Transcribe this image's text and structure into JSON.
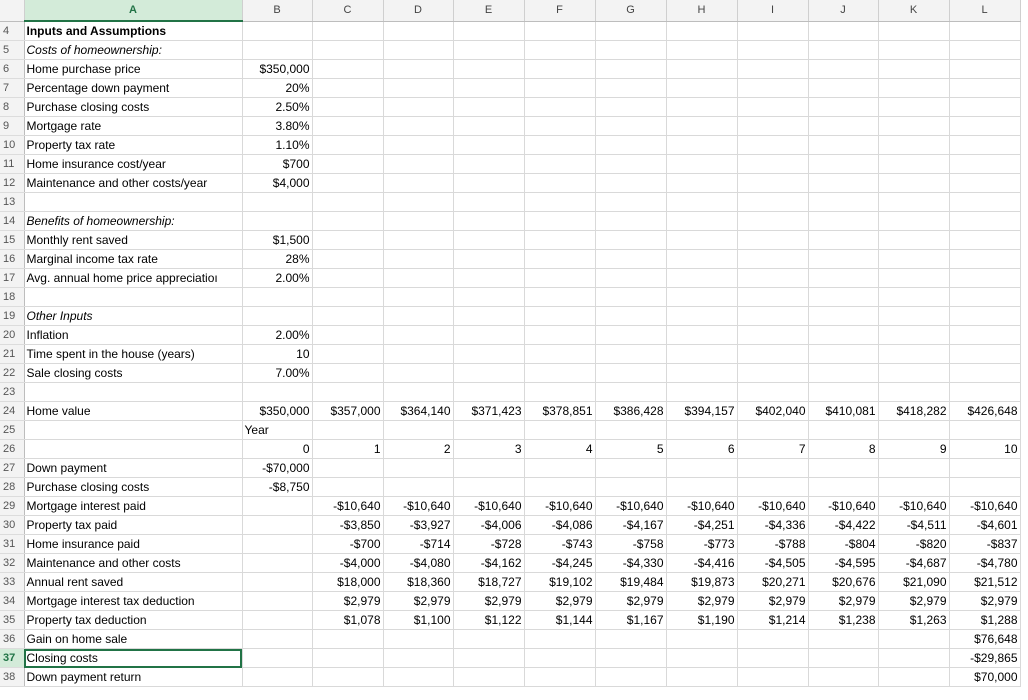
{
  "columns": [
    "A",
    "B",
    "C",
    "D",
    "E",
    "F",
    "G",
    "H",
    "I",
    "J",
    "K",
    "L"
  ],
  "active_cell": {
    "row": "37",
    "col": "A"
  },
  "rows": [
    {
      "n": "4",
      "cells": [
        "Inputs and Assumptions",
        "",
        "",
        "",
        "",
        "",
        "",
        "",
        "",
        "",
        "",
        ""
      ],
      "style": "bold"
    },
    {
      "n": "5",
      "cells": [
        "Costs of homeownership:",
        "",
        "",
        "",
        "",
        "",
        "",
        "",
        "",
        "",
        "",
        ""
      ],
      "style": "italic"
    },
    {
      "n": "6",
      "cells": [
        "Home purchase price",
        "$350,000",
        "",
        "",
        "",
        "",
        "",
        "",
        "",
        "",
        "",
        ""
      ]
    },
    {
      "n": "7",
      "cells": [
        "Percentage down payment",
        "20%",
        "",
        "",
        "",
        "",
        "",
        "",
        "",
        "",
        "",
        ""
      ]
    },
    {
      "n": "8",
      "cells": [
        "Purchase closing costs",
        "2.50%",
        "",
        "",
        "",
        "",
        "",
        "",
        "",
        "",
        "",
        ""
      ]
    },
    {
      "n": "9",
      "cells": [
        "Mortgage rate",
        "3.80%",
        "",
        "",
        "",
        "",
        "",
        "",
        "",
        "",
        "",
        ""
      ]
    },
    {
      "n": "10",
      "cells": [
        "Property tax rate",
        "1.10%",
        "",
        "",
        "",
        "",
        "",
        "",
        "",
        "",
        "",
        ""
      ]
    },
    {
      "n": "11",
      "cells": [
        "Home insurance cost/year",
        "$700",
        "",
        "",
        "",
        "",
        "",
        "",
        "",
        "",
        "",
        ""
      ]
    },
    {
      "n": "12",
      "cells": [
        "Maintenance and other costs/year",
        "$4,000",
        "",
        "",
        "",
        "",
        "",
        "",
        "",
        "",
        "",
        ""
      ]
    },
    {
      "n": "13",
      "cells": [
        "",
        "",
        "",
        "",
        "",
        "",
        "",
        "",
        "",
        "",
        "",
        ""
      ]
    },
    {
      "n": "14",
      "cells": [
        "Benefits of homeownership:",
        "",
        "",
        "",
        "",
        "",
        "",
        "",
        "",
        "",
        "",
        ""
      ],
      "style": "italic"
    },
    {
      "n": "15",
      "cells": [
        "Monthly rent saved",
        "$1,500",
        "",
        "",
        "",
        "",
        "",
        "",
        "",
        "",
        "",
        ""
      ]
    },
    {
      "n": "16",
      "cells": [
        "Marginal income tax rate",
        "28%",
        "",
        "",
        "",
        "",
        "",
        "",
        "",
        "",
        "",
        ""
      ]
    },
    {
      "n": "17",
      "cells": [
        "Avg. annual home price appreciatioı",
        "2.00%",
        "",
        "",
        "",
        "",
        "",
        "",
        "",
        "",
        "",
        ""
      ]
    },
    {
      "n": "18",
      "cells": [
        "",
        "",
        "",
        "",
        "",
        "",
        "",
        "",
        "",
        "",
        "",
        ""
      ]
    },
    {
      "n": "19",
      "cells": [
        "Other Inputs",
        "",
        "",
        "",
        "",
        "",
        "",
        "",
        "",
        "",
        "",
        ""
      ],
      "style": "italic"
    },
    {
      "n": "20",
      "cells": [
        "Inflation",
        "2.00%",
        "",
        "",
        "",
        "",
        "",
        "",
        "",
        "",
        "",
        ""
      ]
    },
    {
      "n": "21",
      "cells": [
        "Time spent in the house (years)",
        "10",
        "",
        "",
        "",
        "",
        "",
        "",
        "",
        "",
        "",
        ""
      ]
    },
    {
      "n": "22",
      "cells": [
        "Sale closing costs",
        "7.00%",
        "",
        "",
        "",
        "",
        "",
        "",
        "",
        "",
        "",
        ""
      ]
    },
    {
      "n": "23",
      "cells": [
        "",
        "",
        "",
        "",
        "",
        "",
        "",
        "",
        "",
        "",
        "",
        ""
      ]
    },
    {
      "n": "24",
      "cells": [
        "Home value",
        "$350,000",
        "$357,000",
        "$364,140",
        "$371,423",
        "$378,851",
        "$386,428",
        "$394,157",
        "$402,040",
        "$410,081",
        "$418,282",
        "$426,648"
      ]
    },
    {
      "n": "25",
      "cells": [
        "",
        "Year",
        "",
        "",
        "",
        "",
        "",
        "",
        "",
        "",
        "",
        ""
      ],
      "leftB": true
    },
    {
      "n": "26",
      "cells": [
        "",
        "0",
        "1",
        "2",
        "3",
        "4",
        "5",
        "6",
        "7",
        "8",
        "9",
        "10"
      ]
    },
    {
      "n": "27",
      "cells": [
        "Down payment",
        "-$70,000",
        "",
        "",
        "",
        "",
        "",
        "",
        "",
        "",
        "",
        ""
      ]
    },
    {
      "n": "28",
      "cells": [
        "Purchase closing costs",
        "-$8,750",
        "",
        "",
        "",
        "",
        "",
        "",
        "",
        "",
        "",
        ""
      ]
    },
    {
      "n": "29",
      "cells": [
        "Mortgage interest paid",
        "",
        "-$10,640",
        "-$10,640",
        "-$10,640",
        "-$10,640",
        "-$10,640",
        "-$10,640",
        "-$10,640",
        "-$10,640",
        "-$10,640",
        "-$10,640"
      ]
    },
    {
      "n": "30",
      "cells": [
        "Property tax paid",
        "",
        "-$3,850",
        "-$3,927",
        "-$4,006",
        "-$4,086",
        "-$4,167",
        "-$4,251",
        "-$4,336",
        "-$4,422",
        "-$4,511",
        "-$4,601"
      ]
    },
    {
      "n": "31",
      "cells": [
        "Home insurance paid",
        "",
        "-$700",
        "-$714",
        "-$728",
        "-$743",
        "-$758",
        "-$773",
        "-$788",
        "-$804",
        "-$820",
        "-$837"
      ]
    },
    {
      "n": "32",
      "cells": [
        "Maintenance and other costs",
        "",
        "-$4,000",
        "-$4,080",
        "-$4,162",
        "-$4,245",
        "-$4,330",
        "-$4,416",
        "-$4,505",
        "-$4,595",
        "-$4,687",
        "-$4,780"
      ]
    },
    {
      "n": "33",
      "cells": [
        "Annual rent saved",
        "",
        "$18,000",
        "$18,360",
        "$18,727",
        "$19,102",
        "$19,484",
        "$19,873",
        "$20,271",
        "$20,676",
        "$21,090",
        "$21,512"
      ]
    },
    {
      "n": "34",
      "cells": [
        "Mortgage interest tax deduction",
        "",
        "$2,979",
        "$2,979",
        "$2,979",
        "$2,979",
        "$2,979",
        "$2,979",
        "$2,979",
        "$2,979",
        "$2,979",
        "$2,979"
      ]
    },
    {
      "n": "35",
      "cells": [
        "Property tax deduction",
        "",
        "$1,078",
        "$1,100",
        "$1,122",
        "$1,144",
        "$1,167",
        "$1,190",
        "$1,214",
        "$1,238",
        "$1,263",
        "$1,288"
      ]
    },
    {
      "n": "36",
      "cells": [
        "Gain on home sale",
        "",
        "",
        "",
        "",
        "",
        "",
        "",
        "",
        "",
        "",
        "$76,648"
      ]
    },
    {
      "n": "37",
      "cells": [
        "Closing costs",
        "",
        "",
        "",
        "",
        "",
        "",
        "",
        "",
        "",
        "",
        "-$29,865"
      ]
    },
    {
      "n": "38",
      "cells": [
        "Down payment return",
        "",
        "",
        "",
        "",
        "",
        "",
        "",
        "",
        "",
        "",
        "$70,000"
      ]
    }
  ]
}
